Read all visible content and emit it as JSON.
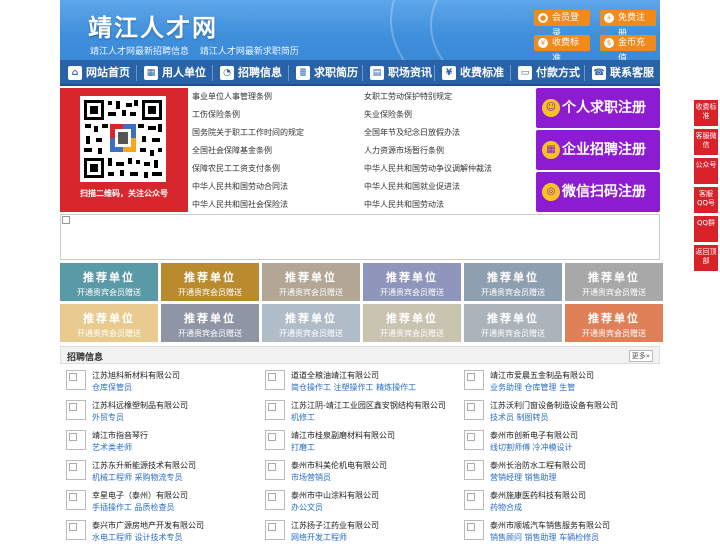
{
  "header": {
    "title": "靖江人才网",
    "sub": [
      "靖江人才网最新招聘信息",
      "靖江人才网最新求职简历"
    ],
    "buttons": [
      {
        "label": "会员登录",
        "icon": "user-icon"
      },
      {
        "label": "免费注册",
        "icon": "register-icon"
      },
      {
        "label": "收费标准",
        "icon": "price-icon"
      },
      {
        "label": "金币充值",
        "icon": "coin-icon"
      }
    ]
  },
  "nav": [
    {
      "label": "网站首页",
      "icon": "home-icon"
    },
    {
      "label": "用人单位",
      "icon": "building-icon"
    },
    {
      "label": "招聘信息",
      "icon": "wifi-icon"
    },
    {
      "label": "求职简历",
      "icon": "resume-icon"
    },
    {
      "label": "职场资讯",
      "icon": "news-icon"
    },
    {
      "label": "收费标准",
      "icon": "price-icon"
    },
    {
      "label": "付款方式",
      "icon": "payment-icon"
    },
    {
      "label": "联系客服",
      "icon": "phone-icon"
    }
  ],
  "qr": {
    "caption": "扫描二维码，关注公众号"
  },
  "links": [
    [
      "事业单位人事管理条例",
      "女职工劳动保护特别规定"
    ],
    [
      "工伤保险条例",
      "失业保险条例"
    ],
    [
      "国务院关于职工工作时间的规定",
      "全国年节及纪念日放假办法"
    ],
    [
      "全国社会保障基金条例",
      "人力资源市场暂行条例"
    ],
    [
      "保障农民工工资支付条例",
      "中华人民共和国劳动争议调解仲裁法"
    ],
    [
      "中华人民共和国劳动合同法",
      "中华人民共和国就业促进法"
    ],
    [
      "中华人民共和国社会保险法",
      "中华人民共和国劳动法"
    ]
  ],
  "register": [
    {
      "label": "个人求职注册",
      "icon": "person-icon"
    },
    {
      "label": "企业招聘注册",
      "icon": "company-icon"
    },
    {
      "label": "微信扫码注册",
      "icon": "wechat-icon"
    }
  ],
  "tiles": {
    "line1": "推荐单位",
    "line2": "开通贵宾会员赠送",
    "colors": [
      "#5a9aa6",
      "#b98b2e",
      "#b3a695",
      "#8f95bb",
      "#8ea0b0",
      "#a8a8a8",
      "#eacb8f",
      "#8e96a6",
      "#b0bdc9",
      "#c8c4b0",
      "#aab4ba",
      "#e08058"
    ]
  },
  "sidebar": [
    "收费标准",
    "客服微信",
    "公众号",
    "客服QQ号",
    "QQ群",
    "返回顶部"
  ],
  "jobs_section": {
    "title": "招聘信息",
    "more": "更多»"
  },
  "jobs": [
    {
      "company": "江苏旭科新材料有限公司",
      "positions": "仓库保管员"
    },
    {
      "company": "道道全粮油靖江有限公司",
      "positions": "简仓操作工  注塑操作工  精炼操作工"
    },
    {
      "company": "靖江市爱晨五金制品有限公司",
      "positions": "业务助理  仓库管理  生管"
    },
    {
      "company": "江苏科远橡塑制品有限公司",
      "positions": "外贸专员"
    },
    {
      "company": "江苏江阴-靖江工业园区鑫安钢结构有限公司",
      "positions": "机修工"
    },
    {
      "company": "江苏沃利门窗设备制造设备有限公司",
      "positions": "技术员  制图转员"
    },
    {
      "company": "靖江市指音琴行",
      "positions": "艺术类老师"
    },
    {
      "company": "靖江市桂泉副磨材料有限公司",
      "positions": "打磨工"
    },
    {
      "company": "泰州市创新电子有限公司",
      "positions": "线切割师傅  冷冲模设计"
    },
    {
      "company": "江苏东升新能源技术有限公司",
      "positions": "机械工程师  采购物流专员"
    },
    {
      "company": "泰州市科美伦机电有限公司",
      "positions": "市场营销员"
    },
    {
      "company": "泰州长治防水工程有限公司",
      "positions": "营销经理  销售助理"
    },
    {
      "company": "幸星电子（泰州）有限公司",
      "positions": "手插操作工  品质检查员"
    },
    {
      "company": "泰州市中山涂料有限公司",
      "positions": "办公文员"
    },
    {
      "company": "泰州施康医药科技有限公司",
      "positions": "药物合成"
    },
    {
      "company": "泰兴市广源房地产开发有限公司",
      "positions": "水电工程师  设计技术专员"
    },
    {
      "company": "江苏扬子江药业有限公司",
      "positions": "网络开发工程师"
    },
    {
      "company": "泰州市顺城汽车销售服务有限公司",
      "positions": "销售顾问  销售助理  车辆检修员"
    }
  ]
}
